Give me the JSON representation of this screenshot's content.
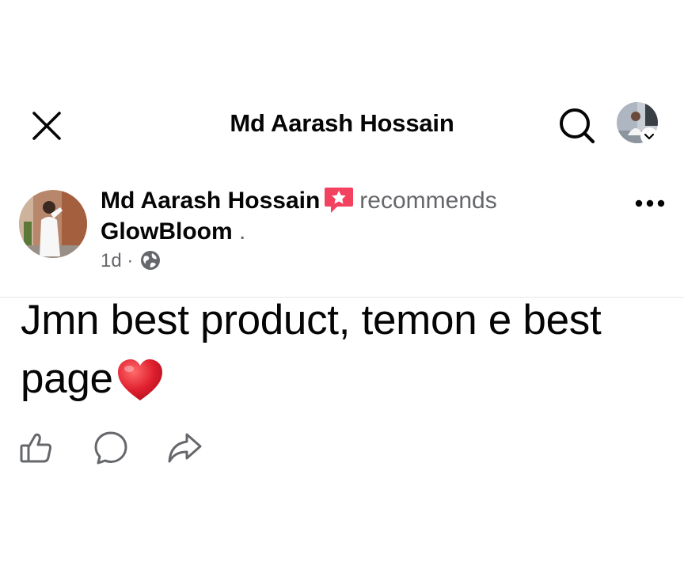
{
  "header": {
    "title": "Md Aarash Hossain",
    "close_icon": "close-icon",
    "search_icon": "search-icon"
  },
  "post": {
    "author": "Md Aarash Hossain",
    "recommend_icon": "recommendation-star-icon",
    "recommends_text": "recommends",
    "page_name": "GlowBloom",
    "page_suffix": " .",
    "time": "1d",
    "separator": " · ",
    "audience_icon": "globe-icon",
    "more_icon": "more-dots-icon",
    "body_text": "Jmn best product, temon e best page",
    "body_emoji": "red-heart-emoji"
  },
  "actions": {
    "like_icon": "like-icon",
    "comment_icon": "comment-icon",
    "share_icon": "share-icon"
  },
  "colors": {
    "text_primary": "#050505",
    "text_secondary": "#65676b",
    "recommend_badge": "#f3425f",
    "heart": "#e0202f",
    "divider": "#e4e6eb"
  }
}
